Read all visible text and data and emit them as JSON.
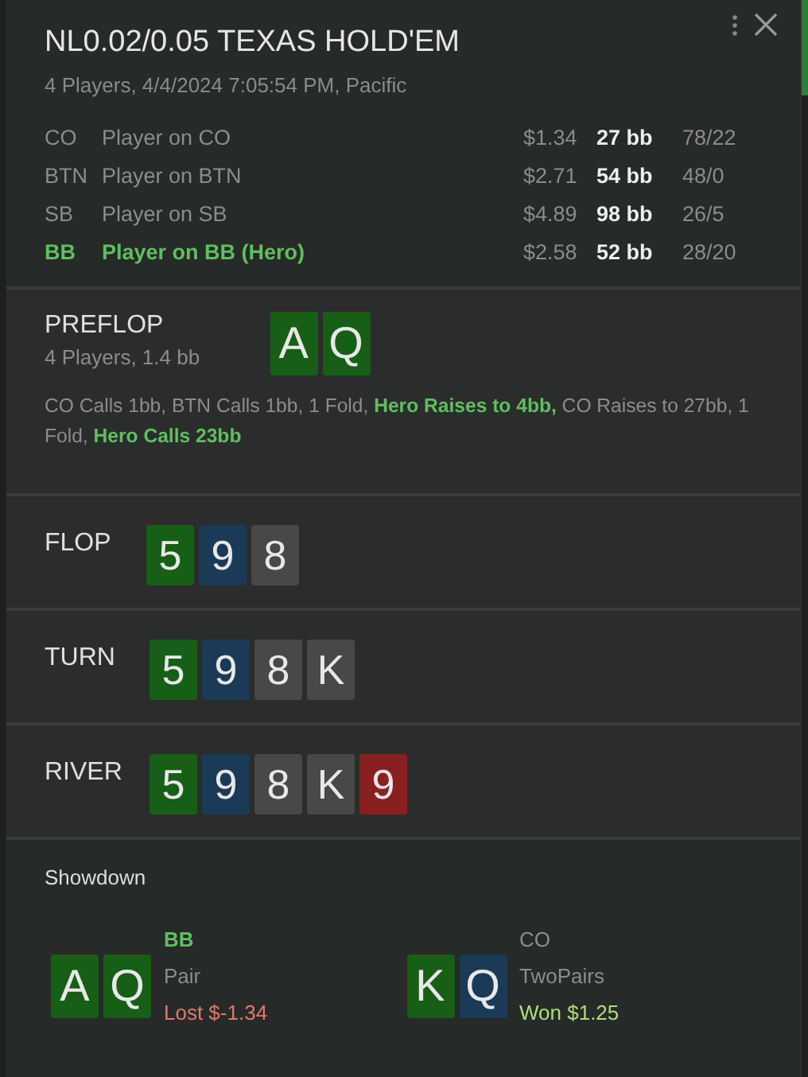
{
  "header": {
    "title": "NL0.02/0.05 TEXAS HOLD'EM",
    "subtitle": "4 Players, 4/4/2024 7:05:54 PM, Pacific"
  },
  "players": [
    {
      "position": "CO",
      "name": "Player on CO",
      "stack": "$1.34",
      "bb": "27 bb",
      "stats": "78/22",
      "hero": false
    },
    {
      "position": "BTN",
      "name": "Player on BTN",
      "stack": "$2.71",
      "bb": "54 bb",
      "stats": "48/0",
      "hero": false
    },
    {
      "position": "SB",
      "name": "Player on SB",
      "stack": "$4.89",
      "bb": "98 bb",
      "stats": "26/5",
      "hero": false
    },
    {
      "position": "BB",
      "name": "Player on BB (Hero)",
      "stack": "$2.58",
      "bb": "52 bb",
      "stats": "28/20",
      "hero": true
    }
  ],
  "preflop": {
    "title": "PREFLOP",
    "info": "4 Players, 1.4 bb",
    "cards": [
      {
        "rank": "A",
        "color": "#175e17"
      },
      {
        "rank": "Q",
        "color": "#175e17"
      }
    ],
    "actions": [
      {
        "text": "CO Calls 1bb, BTN Calls 1bb, 1 Fold, ",
        "hero": false
      },
      {
        "text": "Hero Raises to 4bb,",
        "hero": true
      },
      {
        "text": " CO Raises to 27bb, 1 Fold, ",
        "hero": false
      },
      {
        "text": "Hero Calls 23bb",
        "hero": true
      }
    ]
  },
  "streets": [
    {
      "title": "FLOP",
      "cards": [
        {
          "rank": "5",
          "color": "#175e17"
        },
        {
          "rank": "9",
          "color": "#1b3a57"
        },
        {
          "rank": "8",
          "color": "#484848"
        }
      ]
    },
    {
      "title": "TURN",
      "cards": [
        {
          "rank": "5",
          "color": "#175e17"
        },
        {
          "rank": "9",
          "color": "#1b3a57"
        },
        {
          "rank": "8",
          "color": "#484848"
        },
        {
          "rank": "K",
          "color": "#484848"
        }
      ]
    },
    {
      "title": "RIVER",
      "cards": [
        {
          "rank": "5",
          "color": "#175e17"
        },
        {
          "rank": "9",
          "color": "#1b3a57"
        },
        {
          "rank": "8",
          "color": "#484848"
        },
        {
          "rank": "K",
          "color": "#484848"
        },
        {
          "rank": "9",
          "color": "#8a1f1f"
        }
      ]
    }
  ],
  "showdown": {
    "title": "Showdown",
    "hands": [
      {
        "cards": [
          {
            "rank": "A",
            "color": "#175e17"
          },
          {
            "rank": "Q",
            "color": "#175e17"
          }
        ],
        "position": "BB",
        "hero": true,
        "hand": "Pair",
        "result": "Lost $-1.34",
        "won": false
      },
      {
        "cards": [
          {
            "rank": "K",
            "color": "#175e17"
          },
          {
            "rank": "Q",
            "color": "#1b3a57"
          }
        ],
        "position": "CO",
        "hero": false,
        "hand": "TwoPairs",
        "result": "Won $1.25",
        "won": true
      }
    ]
  }
}
